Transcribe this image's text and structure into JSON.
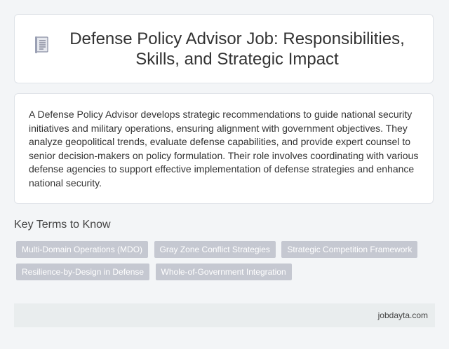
{
  "header": {
    "icon": "document-icon",
    "title": "Defense Policy Advisor Job: Responsibilities, Skills, and Strategic Impact"
  },
  "description": "A Defense Policy Advisor develops strategic recommendations to guide national security initiatives and military operations, ensuring alignment with government objectives. They analyze geopolitical trends, evaluate defense capabilities, and provide expert counsel to senior decision-makers on policy formulation. Their role involves coordinating with various defense agencies to support effective implementation of defense strategies and enhance national security.",
  "key_terms": {
    "heading": "Key Terms to Know",
    "tags": [
      "Multi-Domain Operations (MDO)",
      "Gray Zone Conflict Strategies",
      "Strategic Competition Framework",
      "Resilience-by-Design in Defense",
      "Whole-of-Government Integration"
    ]
  },
  "footer": {
    "source": "jobdayta.com"
  },
  "colors": {
    "background": "#f3f5f7",
    "card": "#ffffff",
    "tag": "#c5c8d1",
    "footer": "#e9edee"
  }
}
